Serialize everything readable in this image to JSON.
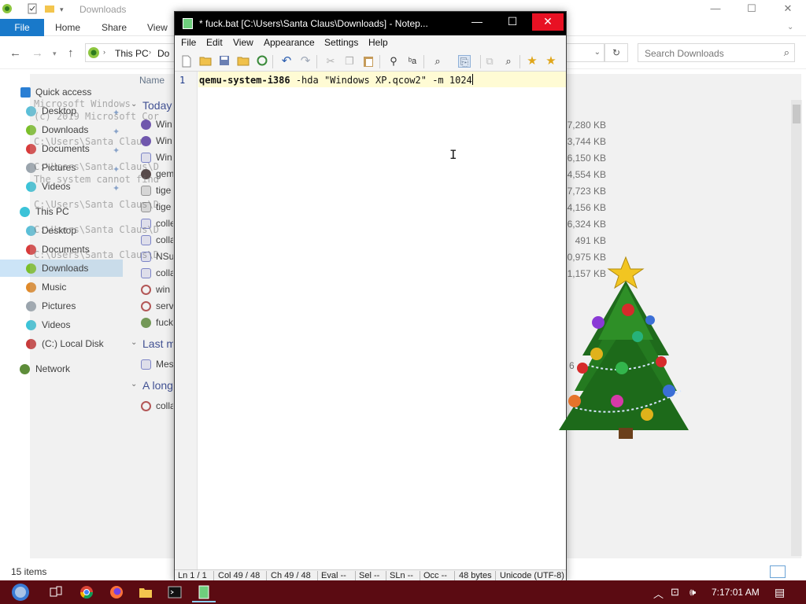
{
  "explorer": {
    "title": "Downloads",
    "tabs": [
      "File",
      "Home",
      "Share",
      "View"
    ],
    "address": "This PC",
    "address_tail": "Do",
    "search_placeholder": "Search Downloads",
    "column_name": "Name",
    "item_count": "15 items",
    "nav": {
      "quick_access": "Quick access",
      "qa_items": [
        "Desktop",
        "Downloads",
        "Documents",
        "Pictures",
        "Videos"
      ],
      "this_pc": "This PC",
      "pc_items": [
        "Desktop",
        "Documents",
        "Downloads",
        "Music",
        "Pictures",
        "Videos",
        "(C:) Local Disk"
      ],
      "network": "Network"
    },
    "groups": [
      "Today",
      "Last m",
      "A long"
    ],
    "files_today": [
      "Win",
      "Win",
      "Win",
      "gem",
      "tige",
      "tige",
      "colle",
      "colla",
      "NSu",
      "colla",
      "win",
      "serv",
      "fuck"
    ],
    "files_last": [
      "Mes"
    ],
    "files_long": [
      "colla"
    ],
    "sizes": [
      "7,280 KB",
      "3,744 KB",
      "6,150 KB",
      "4,554 KB",
      "7,723 KB",
      "4,156 KB",
      "6,324 KB",
      "491 KB",
      "0,975 KB",
      "1,157 KB"
    ],
    "ghost_size": "6"
  },
  "cmd_ghost": {
    "lines": [
      "Microsoft Windows",
      "(c) 2019 Microsoft Cor",
      "C:\\Users\\Santa Clau",
      "C:\\Users\\Santa Claus\\D",
      "The system cannot find",
      "C:\\Users\\Santa Claus\\D",
      "C:\\Users\\Santa Claus\\D",
      "C:\\Users\\Santa Claus\\D"
    ]
  },
  "notepad": {
    "title": "* fuck.bat [C:\\Users\\Santa Claus\\Downloads] - Notep...",
    "menu": [
      "File",
      "Edit",
      "View",
      "Appearance",
      "Settings",
      "Help"
    ],
    "line_number": "1",
    "code_cmd": "qemu-system-i386",
    "code_args": " -hda \"Windows XP.qcow2\" -m 1024",
    "status": {
      "ln": "Ln 1 / 1",
      "col": "Col 49 / 48",
      "ch": "Ch 49 / 48",
      "eval": "Eval --",
      "sel": "Sel --",
      "sln": "SLn --",
      "occ": "Occ --",
      "bytes": "48 bytes",
      "enc": "Unicode (UTF-8)"
    }
  },
  "taskbar": {
    "clock": "7:17:01 AM"
  },
  "colors": {
    "taskbar": "#5b0b12",
    "file_tab": "#1979ca",
    "close_button": "#e81123",
    "current_line": "#fffbd4"
  }
}
